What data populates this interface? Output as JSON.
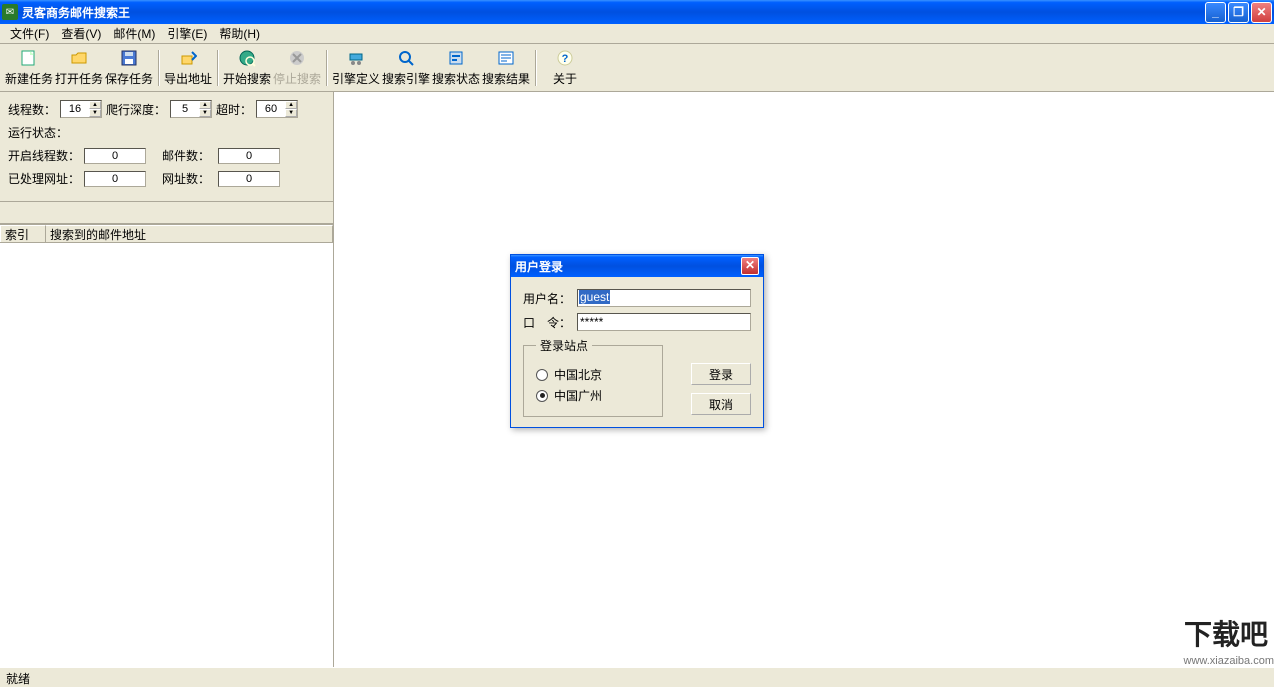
{
  "title": "灵客商务邮件搜索王",
  "menus": {
    "file": "文件(F)",
    "view": "查看(V)",
    "mail": "邮件(M)",
    "engine": "引擎(E)",
    "help": "帮助(H)"
  },
  "toolbar": {
    "new_task": "新建任务",
    "open_task": "打开任务",
    "save_task": "保存任务",
    "export_addr": "导出地址",
    "start_search": "开始搜索",
    "stop_search": "停止搜索",
    "engine_def": "引擎定义",
    "search_engine": "搜索引擎",
    "search_status": "搜索状态",
    "search_result": "搜索结果",
    "about": "关于"
  },
  "params": {
    "threads_label": "线程数：",
    "threads_value": "16",
    "depth_label": "爬行深度：",
    "depth_value": "5",
    "timeout_label": "超时：",
    "timeout_value": "60",
    "status_label": "运行状态：",
    "open_threads_label": "开启线程数：",
    "open_threads_value": "0",
    "mail_count_label": "邮件数：",
    "mail_count_value": "0",
    "processed_label": "已处理网址：",
    "processed_value": "0",
    "url_count_label": "网址数：",
    "url_count_value": "0"
  },
  "list": {
    "col_index": "索引",
    "col_addr": "搜索到的邮件地址"
  },
  "dialog": {
    "title": "用户登录",
    "username_label": "用户名：",
    "username_value": "guest",
    "password_label": "口　令：",
    "password_value": "*****",
    "site_legend": "登录站点",
    "site_beijing": "中国北京",
    "site_guangzhou": "中国广州",
    "login_btn": "登录",
    "cancel_btn": "取消"
  },
  "statusbar": "就绪",
  "watermark": {
    "big": "下载吧",
    "small": "www.xiazaiba.com"
  }
}
